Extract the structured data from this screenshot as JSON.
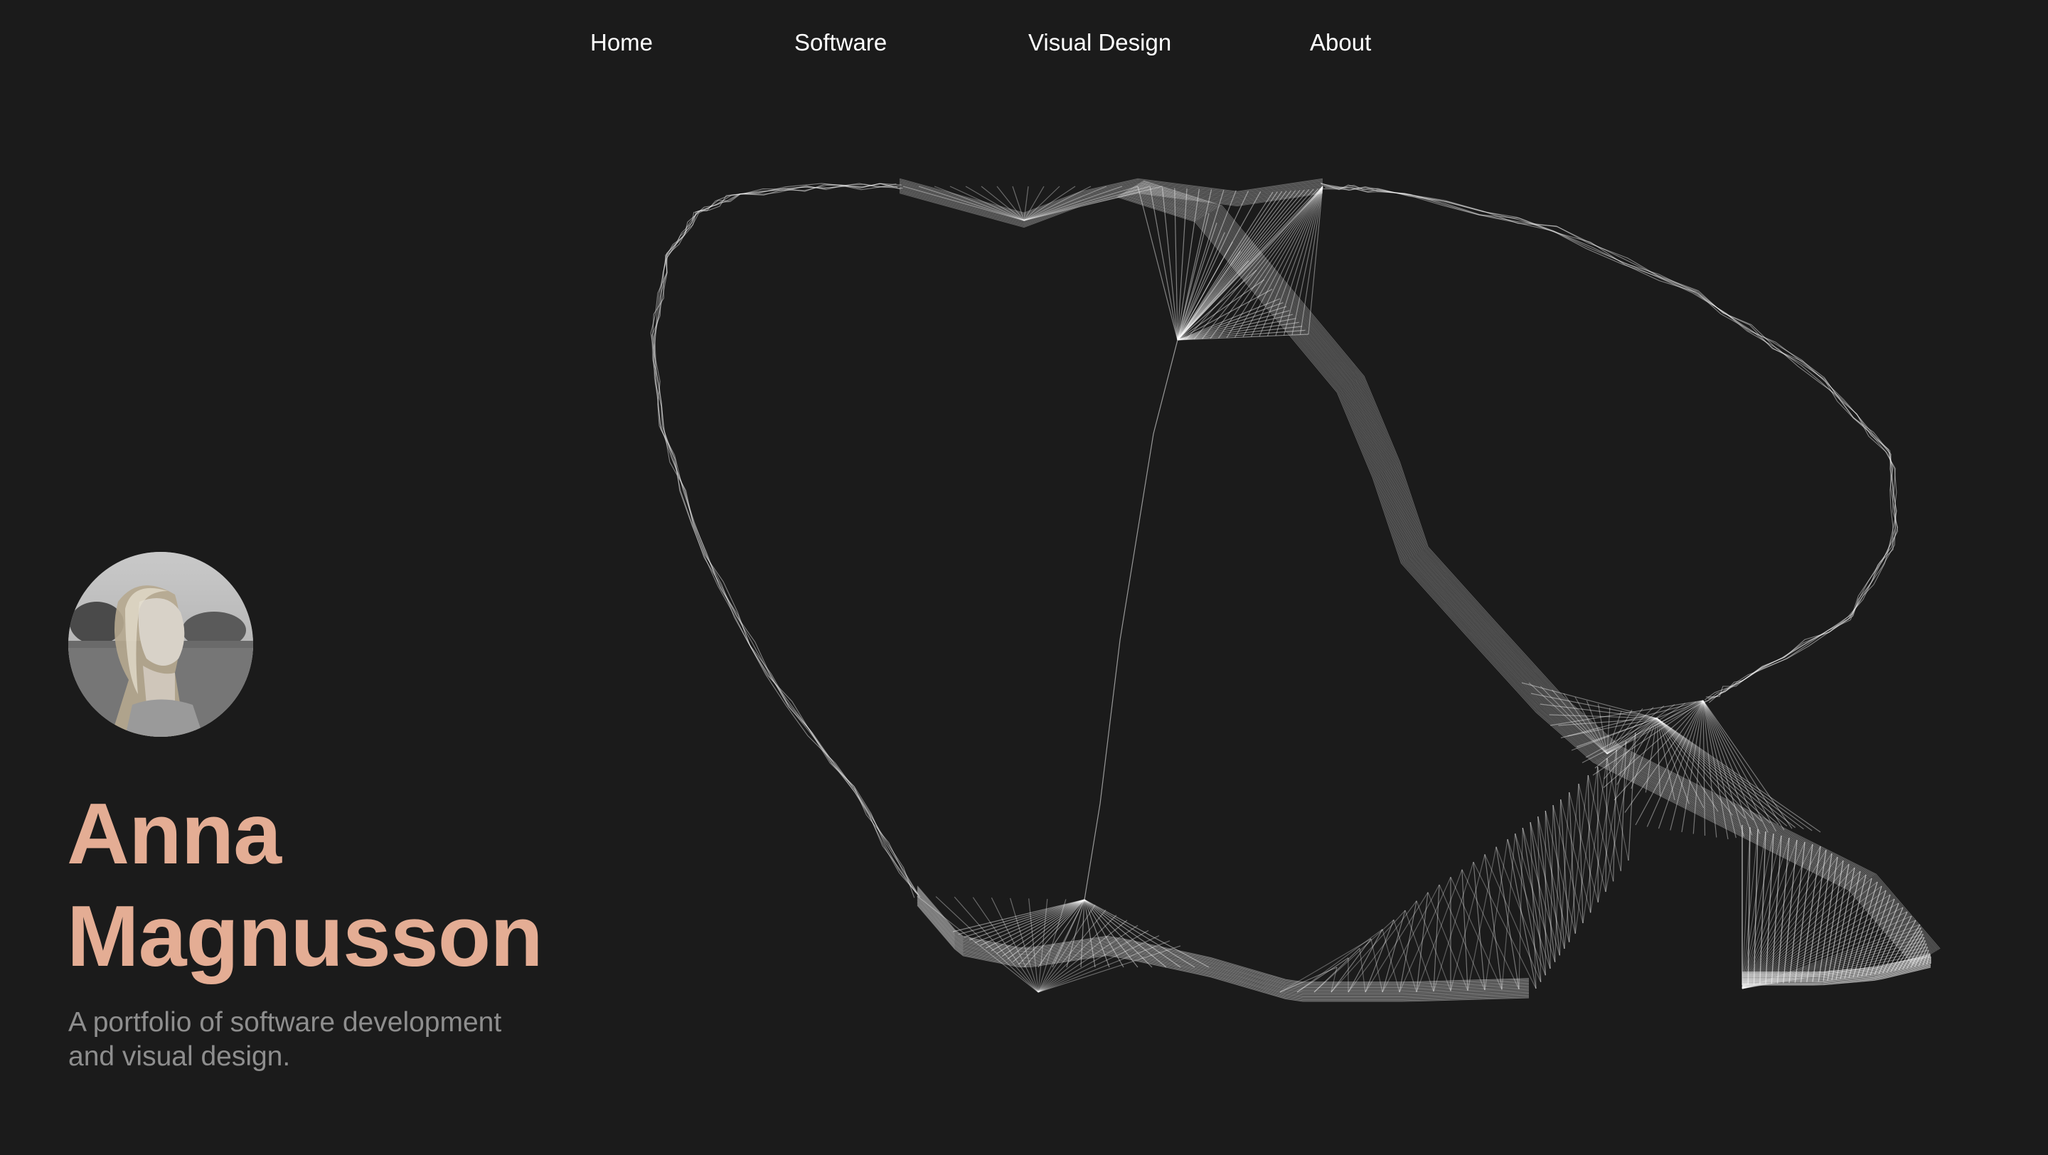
{
  "nav": {
    "items": [
      {
        "label": "Home"
      },
      {
        "label": "Software"
      },
      {
        "label": "Visual Design"
      },
      {
        "label": "About"
      }
    ]
  },
  "hero": {
    "first_name": "Anna",
    "last_name": "Magnusson",
    "tagline_line1": "A portfolio of software development",
    "tagline_line2": "and visual design."
  },
  "colors": {
    "background": "#1b1b1b",
    "accent": "#e4ad94",
    "nav_text": "#ffffff",
    "tagline": "#8e8e8e",
    "art_stroke": "#ffffff"
  },
  "icons": {
    "avatar": "profile-photo-grayscale"
  }
}
